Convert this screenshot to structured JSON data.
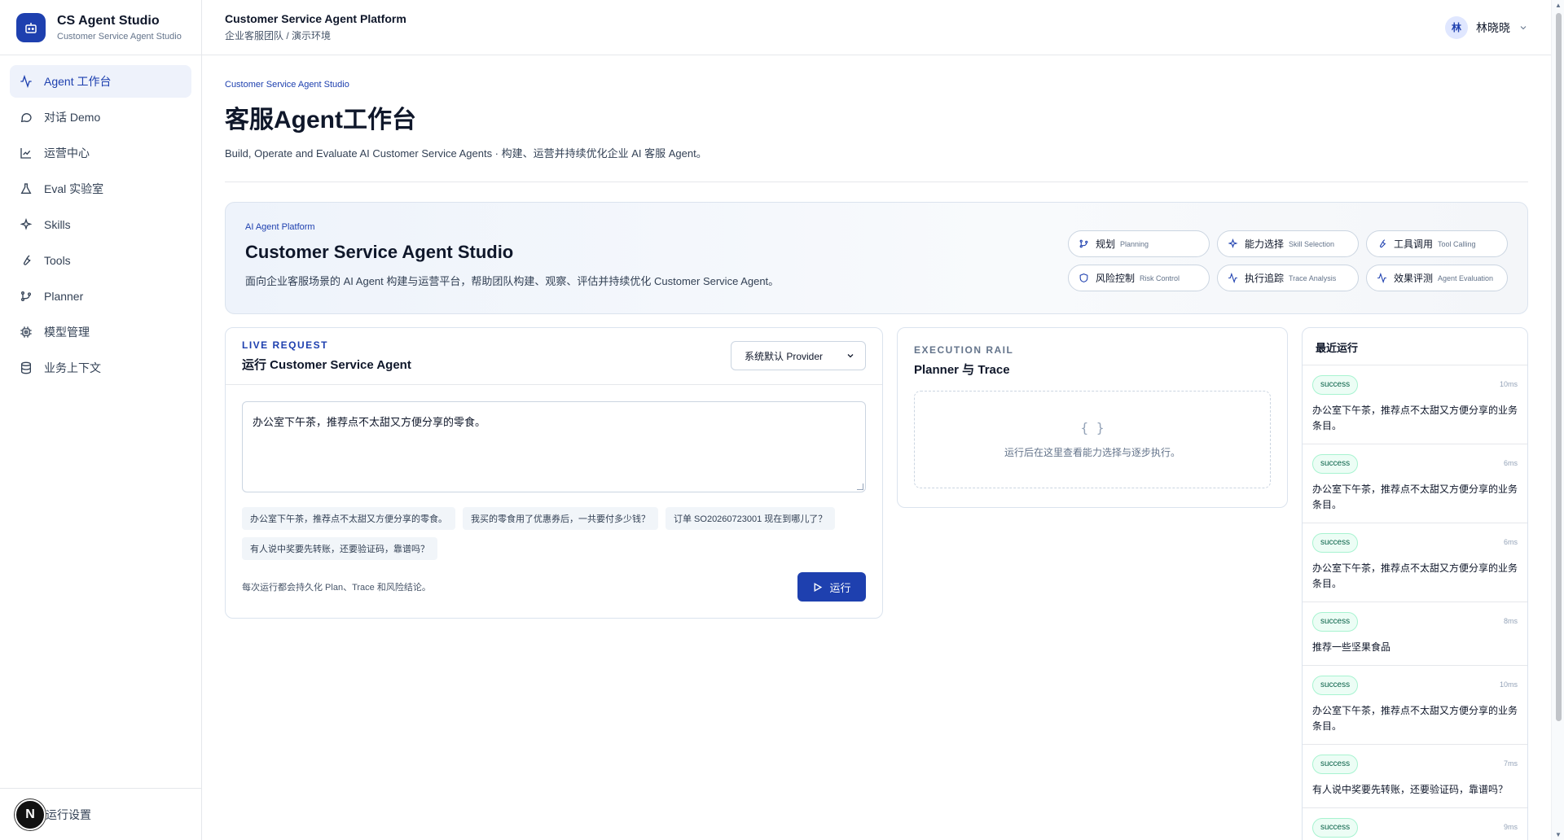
{
  "brand": {
    "title": "CS Agent Studio",
    "subtitle": "Customer Service Agent Studio"
  },
  "sidebar": {
    "items": [
      {
        "label": "Agent 工作台",
        "icon": "activity-icon",
        "active": true
      },
      {
        "label": "对话 Demo",
        "icon": "chat-bubble-icon"
      },
      {
        "label": "运营中心",
        "icon": "chart-icon"
      },
      {
        "label": "Eval 实验室",
        "icon": "flask-icon"
      },
      {
        "label": "Skills",
        "icon": "sparkles-icon"
      },
      {
        "label": "Tools",
        "icon": "wrench-icon"
      },
      {
        "label": "Planner",
        "icon": "git-branch-icon"
      },
      {
        "label": "模型管理",
        "icon": "cpu-icon"
      },
      {
        "label": "业务上下文",
        "icon": "database-icon"
      }
    ],
    "footer_badge": "N",
    "footer_label": "运行设置"
  },
  "header": {
    "title": "Customer Service Agent Platform",
    "subtitle": "企业客服团队 / 演示环境",
    "user_initial": "林",
    "user_name": "林晓晓"
  },
  "page": {
    "eyebrow": "Customer Service Agent Studio",
    "title": "客服Agent工作台",
    "description": "Build, Operate and Evaluate AI Customer Service Agents · 构建、运营并持续优化企业 AI 客服 Agent。"
  },
  "hero": {
    "eyebrow": "AI Agent Platform",
    "title": "Customer Service Agent Studio",
    "description": "面向企业客服场景的 AI Agent 构建与运营平台，帮助团队构建、观察、评估并持续优化 Customer Service Agent。",
    "chips": [
      {
        "label": "规划",
        "en": "Planning",
        "icon": "git-branch-icon"
      },
      {
        "label": "能力选择",
        "en": "Skill Selection",
        "icon": "sparkles-icon"
      },
      {
        "label": "工具调用",
        "en": "Tool Calling",
        "icon": "wrench-icon"
      },
      {
        "label": "风险控制",
        "en": "Risk Control",
        "icon": "shield-icon"
      },
      {
        "label": "执行追踪",
        "en": "Trace Analysis",
        "icon": "activity-icon"
      },
      {
        "label": "效果评测",
        "en": "Agent Evaluation",
        "icon": "activity-icon"
      }
    ]
  },
  "live": {
    "tag": "LIVE REQUEST",
    "title": "运行 Customer Service Agent",
    "provider": "系统默认 Provider",
    "input_value": "办公室下午茶，推荐点不太甜又方便分享的零食。",
    "examples": [
      "办公室下午茶，推荐点不太甜又方便分享的零食。",
      "我买的零食用了优惠券后，一共要付多少钱？",
      "订单 SO20260723001 现在到哪儿了？",
      "有人说中奖要先转账，还要验证码，靠谱吗？"
    ],
    "footer_note": "每次运行都会持久化 Plan、Trace 和风险结论。",
    "run_label": "运行"
  },
  "rail": {
    "tag": "EXECUTION RAIL",
    "title": "Planner 与 Trace",
    "empty_icon": "{ }",
    "empty_text": "运行后在这里查看能力选择与逐步执行。"
  },
  "recent": {
    "title": "最近运行",
    "runs": [
      {
        "status": "success",
        "ms": "10ms",
        "text": "办公室下午茶，推荐点不太甜又方便分享的业务条目。"
      },
      {
        "status": "success",
        "ms": "6ms",
        "text": "办公室下午茶，推荐点不太甜又方便分享的业务条目。"
      },
      {
        "status": "success",
        "ms": "6ms",
        "text": "办公室下午茶，推荐点不太甜又方便分享的业务条目。"
      },
      {
        "status": "success",
        "ms": "8ms",
        "text": "推荐一些坚果食品"
      },
      {
        "status": "success",
        "ms": "10ms",
        "text": "办公室下午茶，推荐点不太甜又方便分享的业务条目。"
      },
      {
        "status": "success",
        "ms": "7ms",
        "text": "有人说中奖要先转账，还要验证码，靠谱吗？"
      },
      {
        "status": "success",
        "ms": "9ms",
        "text": ""
      }
    ]
  },
  "colors": {
    "accent": "#1e40af",
    "success_bg": "#ecfdf5",
    "success_text": "#065f46"
  }
}
